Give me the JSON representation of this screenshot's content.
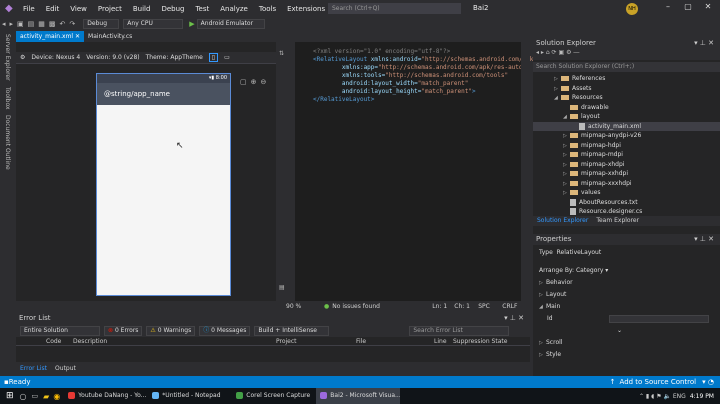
{
  "menu": {
    "items": [
      "File",
      "Edit",
      "View",
      "Project",
      "Build",
      "Debug",
      "Test",
      "Analyze",
      "Tools",
      "Extensions",
      "Window",
      "Help"
    ],
    "search_placeholder": "Search (Ctrl+Q)",
    "solution_name": "Bai2",
    "user_initials": "NH"
  },
  "toolbar": {
    "config": "Debug",
    "platform": "Any CPU",
    "run_target": "Android Emulator"
  },
  "side_tabs": [
    "Server Explorer",
    "Toolbox",
    "Document Outline"
  ],
  "doc_tabs": [
    {
      "label": "activity_main.xml",
      "active": true
    },
    {
      "label": "MainActivity.cs",
      "active": false
    }
  ],
  "designer": {
    "device_label": "Device:",
    "device": "Nexus 4",
    "version_label": "Version:",
    "version": "9.0 (v28)",
    "theme_label": "Theme:",
    "theme": "AppTheme",
    "phone_time": "8:00",
    "app_name": "@string/app_name"
  },
  "code_lines": [
    [
      [
        "pi",
        "<?xml version=\"1.0\" encoding=\"utf-8\"?>"
      ]
    ],
    [
      [
        "tg",
        "<RelativeLayout "
      ],
      [
        "at",
        "xmlns:android="
      ],
      [
        "st",
        "\"http://schemas.android.com/apk/res/android\""
      ]
    ],
    [
      [
        "at",
        "        xmlns:app="
      ],
      [
        "st",
        "\"http://schemas.android.com/apk/res-auto\""
      ]
    ],
    [
      [
        "at",
        "        xmlns:tools="
      ],
      [
        "st",
        "\"http://schemas.android.com/tools\""
      ]
    ],
    [
      [
        "at",
        "        android:layout_width="
      ],
      [
        "st",
        "\"match_parent\""
      ]
    ],
    [
      [
        "at",
        "        android:layout_height="
      ],
      [
        "st",
        "\"match_parent\""
      ],
      [
        "tg",
        ">"
      ]
    ],
    [
      [
        "tg",
        "</RelativeLayout>"
      ]
    ]
  ],
  "editor_status": {
    "zoom": "90 %",
    "issues": "No issues found",
    "line": "Ln: 1",
    "col": "Ch: 1",
    "spc": "SPC",
    "crlf": "CRLF"
  },
  "error_list": {
    "title": "Error List",
    "scope": "Entire Solution",
    "errors": "0 Errors",
    "warnings": "0 Warnings",
    "messages": "0 Messages",
    "build": "Build + IntelliSense",
    "search_placeholder": "Search Error List",
    "columns": [
      "Code",
      "Description",
      "Project",
      "File",
      "Line",
      "Suppression State"
    ]
  },
  "bottom_tabs": [
    "Error List",
    "Output"
  ],
  "solution_explorer": {
    "title": "Solution Explorer",
    "search_placeholder": "Search Solution Explorer (Ctrl+;)",
    "tree": [
      {
        "label": "References",
        "depth": 1,
        "type": "folder",
        "expander": "right"
      },
      {
        "label": "Assets",
        "depth": 1,
        "type": "folder",
        "expander": "right"
      },
      {
        "label": "Resources",
        "depth": 1,
        "type": "folder",
        "expander": "down"
      },
      {
        "label": "drawable",
        "depth": 2,
        "type": "folder",
        "expander": ""
      },
      {
        "label": "layout",
        "depth": 2,
        "type": "folder",
        "expander": "down"
      },
      {
        "label": "activity_main.xml",
        "depth": 3,
        "type": "file",
        "expander": ""
      },
      {
        "label": "mipmap-anydpi-v26",
        "depth": 2,
        "type": "folder",
        "expander": "right"
      },
      {
        "label": "mipmap-hdpi",
        "depth": 2,
        "type": "folder",
        "expander": "right"
      },
      {
        "label": "mipmap-mdpi",
        "depth": 2,
        "type": "folder",
        "expander": "right"
      },
      {
        "label": "mipmap-xhdpi",
        "depth": 2,
        "type": "folder",
        "expander": "right"
      },
      {
        "label": "mipmap-xxhdpi",
        "depth": 2,
        "type": "folder",
        "expander": "right"
      },
      {
        "label": "mipmap-xxxhdpi",
        "depth": 2,
        "type": "folder",
        "expander": "right"
      },
      {
        "label": "values",
        "depth": 2,
        "type": "folder",
        "expander": "right"
      },
      {
        "label": "AboutResources.txt",
        "depth": 2,
        "type": "file",
        "expander": ""
      },
      {
        "label": "Resource.designer.cs",
        "depth": 2,
        "type": "file",
        "expander": ""
      }
    ],
    "tabs": [
      "Solution Explorer",
      "Team Explorer"
    ]
  },
  "properties": {
    "title": "Properties",
    "type_label": "Type",
    "type_value": "RelativeLayout",
    "arrange": "Arrange By: Category",
    "categories": [
      {
        "label": "Behavior",
        "expander": "right"
      },
      {
        "label": "Layout",
        "expander": "right"
      },
      {
        "label": "Main",
        "expander": "down"
      },
      {
        "label": "Scroll",
        "expander": "right"
      },
      {
        "label": "Style",
        "expander": "right"
      }
    ],
    "id_label": "Id"
  },
  "status": {
    "ready": "Ready",
    "source_control": "Add to Source Control"
  },
  "taskbar": {
    "items": [
      {
        "label": "Youtube DaNang - Yo...",
        "color": "#e53935",
        "active": false
      },
      {
        "label": "*Untitled - Notepad",
        "color": "#64b5f6",
        "active": false
      },
      {
        "label": "Corel Screen Capture",
        "color": "#43a047",
        "active": false
      },
      {
        "label": "Bai2 - Microsoft Visua...",
        "color": "#9c6ade",
        "active": true
      }
    ],
    "time": "4:19 PM",
    "date": "11/26/2019"
  },
  "colors": {
    "accent": "#007acc",
    "ide_bg": "#2d2d30"
  }
}
